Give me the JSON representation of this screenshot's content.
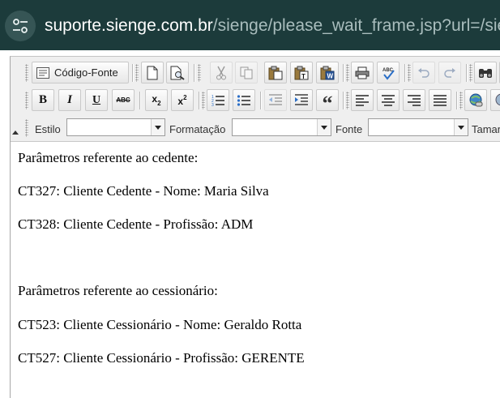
{
  "browser": {
    "url_host": "suporte.sienge.com.br",
    "url_path": "/sienge/please_wait_frame.jsp?url=/sie",
    "site_info_icon": "tune-icon"
  },
  "toolbar": {
    "source_button_label": "Código-Fonte",
    "row1_icons": [
      "new-page-icon",
      "preview-icon",
      "cut-icon",
      "copy-icon",
      "paste-icon",
      "paste-text-icon",
      "paste-word-icon",
      "print-icon",
      "spellcheck-icon",
      "undo-icon",
      "redo-icon",
      "find-icon"
    ],
    "row2_icons": [
      "bold-icon",
      "italic-icon",
      "underline-icon",
      "strikethrough-icon",
      "subscript-icon",
      "superscript-icon",
      "numbered-list-icon",
      "bulleted-list-icon",
      "outdent-icon",
      "indent-icon",
      "blockquote-icon",
      "align-left-icon",
      "align-center-icon",
      "align-right-icon",
      "justify-icon",
      "link-icon",
      "unlink-icon"
    ],
    "bold_glyph": "B",
    "italic_glyph": "I",
    "underline_glyph": "U",
    "strike_glyph": "ABC",
    "sub_glyph": "x",
    "sub_mark": "2",
    "sup_glyph": "x",
    "sup_mark": "2",
    "quote_glyph": "“",
    "style_label": "Estilo",
    "style_value": "",
    "format_label": "Formatação",
    "format_value": "",
    "font_label": "Fonte",
    "font_value": "",
    "size_label": "Taman"
  },
  "document": {
    "paragraphs": [
      "Parâmetros referente ao cedente:",
      "CT327: Cliente Cedente - Nome: Maria Silva",
      "CT328: Cliente Cedente - Profissão: ADM",
      "Parâmetros referente ao cessionário:",
      "CT523: Cliente Cessionário - Nome: Geraldo Rotta",
      "CT527: Cliente Cessionário - Profissão: GERENTE"
    ]
  },
  "colors": {
    "urlbar_bg": "#1c3b3b",
    "url_host": "#ffffff",
    "url_path": "#a9bdbd",
    "toolbar_bg": "#efefef"
  }
}
